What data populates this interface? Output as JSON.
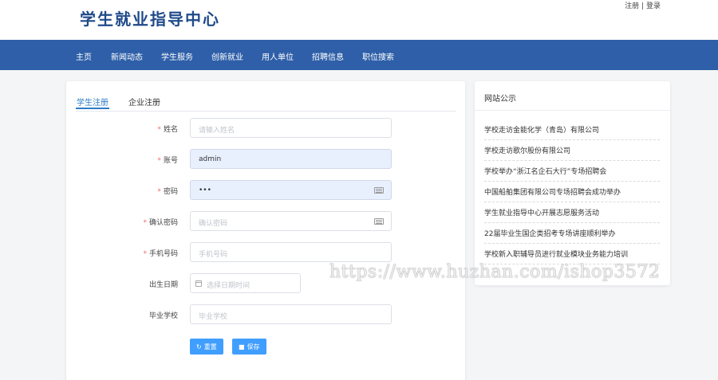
{
  "header": {
    "title": "学生就业指导中心",
    "register_label": "注册",
    "separator": "|",
    "login_label": "登录"
  },
  "nav": {
    "items": [
      {
        "label": "主页"
      },
      {
        "label": "新闻动态"
      },
      {
        "label": "学生服务"
      },
      {
        "label": "创新就业"
      },
      {
        "label": "用人单位"
      },
      {
        "label": "招聘信息"
      },
      {
        "label": "职位搜索"
      }
    ],
    "background": "#2e5fa8"
  },
  "form": {
    "tabs": [
      {
        "label": "学生注册",
        "active": true
      },
      {
        "label": "企业注册",
        "active": false
      }
    ],
    "fields": {
      "name": {
        "label": "姓名",
        "required": true,
        "placeholder": "请输入姓名",
        "value": ""
      },
      "account": {
        "label": "账号",
        "required": true,
        "placeholder": "",
        "value": "admin"
      },
      "password": {
        "label": "密码",
        "required": true,
        "placeholder": "",
        "value": "•••"
      },
      "confirm_password": {
        "label": "确认密码",
        "required": true,
        "placeholder": "确认密码",
        "value": ""
      },
      "phone": {
        "label": "手机号码",
        "required": true,
        "placeholder": "手机号码",
        "value": ""
      },
      "birthdate": {
        "label": "出生日期",
        "required": false,
        "placeholder": "选择日期时间",
        "value": ""
      },
      "school": {
        "label": "毕业学校",
        "required": false,
        "placeholder": "毕业学校",
        "value": ""
      }
    },
    "reset_label": "重置",
    "save_label": "保存",
    "accent": "#409eff"
  },
  "notices": {
    "title": "网站公示",
    "items": [
      {
        "text": "学校走访金能化学（青岛）有限公司"
      },
      {
        "text": "学校走访歌尔股份有限公司"
      },
      {
        "text": "学校举办“浙江名企石大行”专场招聘会"
      },
      {
        "text": "中国船舶集团有限公司专场招聘会成功举办"
      },
      {
        "text": "学生就业指导中心开展志愿服务活动"
      },
      {
        "text": "22届毕业生国企类招考专场讲座顺利举办"
      },
      {
        "text": "学校新入职辅导员进行就业模块业务能力培训"
      }
    ]
  },
  "watermark": "https://www.huzhan.com/ishop3572"
}
